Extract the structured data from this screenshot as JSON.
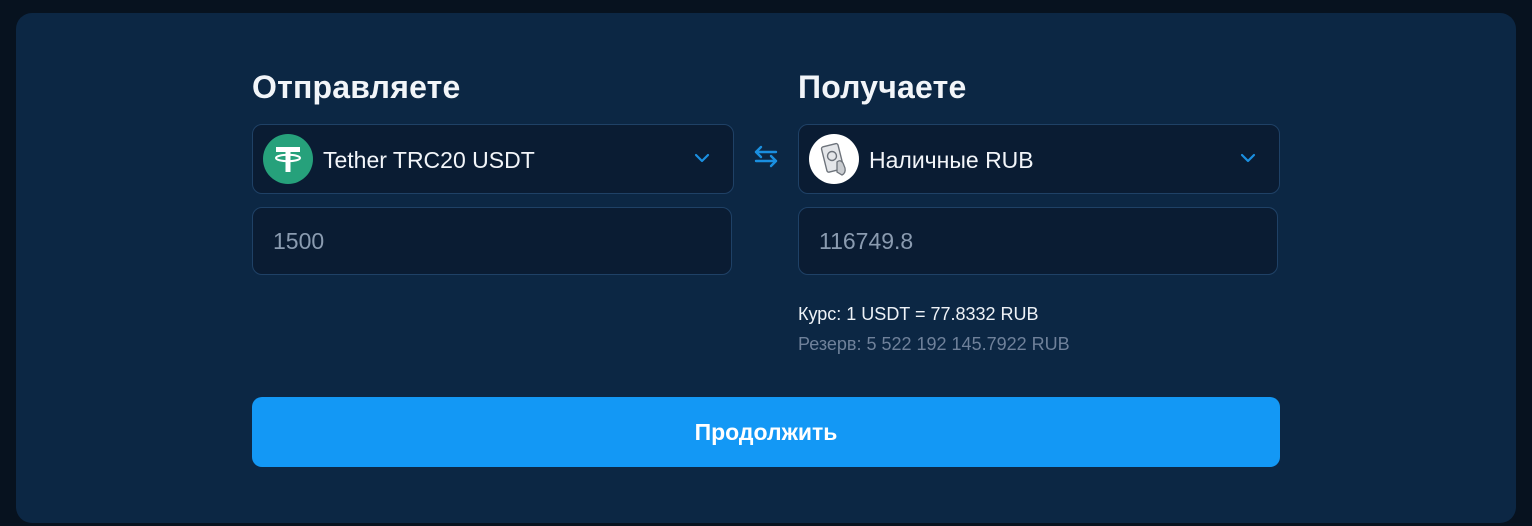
{
  "send": {
    "heading": "Отправляете",
    "currency": "Tether TRC20 USDT",
    "currency_icon": "tether-icon",
    "amount_value": "1500"
  },
  "receive": {
    "heading": "Получаете",
    "currency": "Наличные RUB",
    "currency_icon": "cash-icon",
    "amount_value": "116749.8",
    "rate": "Курс: 1 USDT = 77.8332 RUB",
    "reserve": "Резерв: 5 522 192 145.7922 RUB"
  },
  "swap_icon": "swap-arrows-icon",
  "continue_label": "Продолжить",
  "colors": {
    "background": "#07121f",
    "card": "#0c2744",
    "field": "#0a1c33",
    "accent": "#1398f5",
    "tether": "#26a17b"
  }
}
